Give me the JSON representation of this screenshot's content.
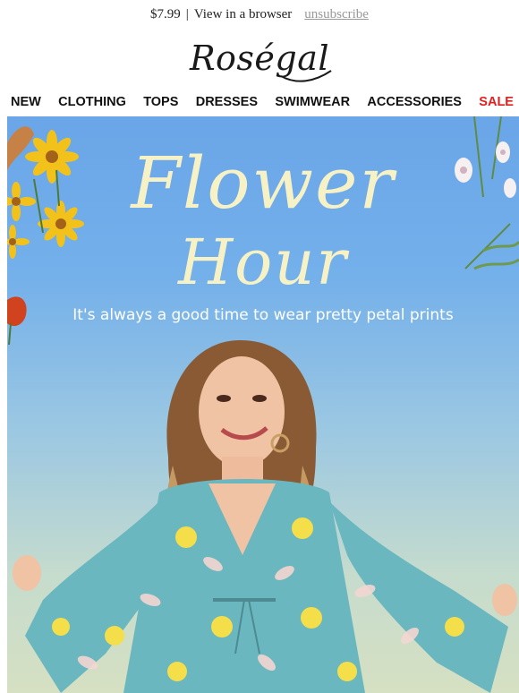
{
  "preheader": {
    "price": "$7.99",
    "separator": "|",
    "view_browser": "View in a browser",
    "unsubscribe": "unsubscribe"
  },
  "brand": {
    "logo_text": "Roségal"
  },
  "nav": {
    "items": [
      "NEW",
      "CLOTHING",
      "TOPS",
      "DRESSES",
      "SWIMWEAR",
      "ACCESSORIES"
    ],
    "sale": "SALE"
  },
  "hero": {
    "title_line1": "Flower",
    "title_line2": "Hour",
    "subtitle": "It's always a good time to wear pretty petal prints"
  },
  "colors": {
    "sale": "#e0201f",
    "title": "#f7f2c6",
    "dress": "#6bb7c0"
  }
}
